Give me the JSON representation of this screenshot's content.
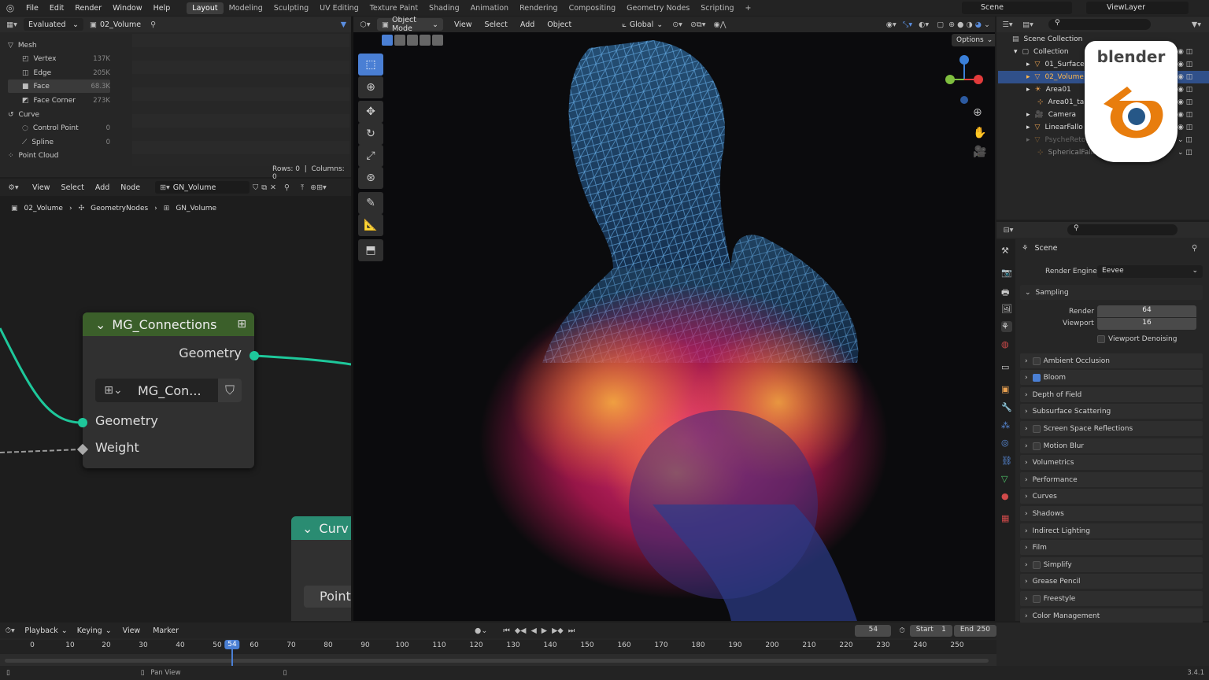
{
  "topbar": {
    "menus": [
      "File",
      "Edit",
      "Render",
      "Window",
      "Help"
    ],
    "workspaces": [
      "Layout",
      "Modeling",
      "Sculpting",
      "UV Editing",
      "Texture Paint",
      "Shading",
      "Animation",
      "Rendering",
      "Compositing",
      "Geometry Nodes",
      "Scripting"
    ],
    "scene": "Scene",
    "view_layer": "ViewLayer"
  },
  "spreadsheet": {
    "mode": "Evaluated",
    "object": "02_Volume",
    "rows_label": "Rows: 0",
    "cols_label": "Columns: 0",
    "items": [
      {
        "label": "Mesh"
      },
      {
        "label": "Vertex",
        "count": "137K"
      },
      {
        "label": "Edge",
        "count": "205K"
      },
      {
        "label": "Face",
        "count": "68.3K"
      },
      {
        "label": "Face Corner",
        "count": "273K"
      },
      {
        "label": "Curve"
      },
      {
        "label": "Control Point",
        "count": "0"
      },
      {
        "label": "Spline",
        "count": "0"
      },
      {
        "label": "Point Cloud"
      }
    ]
  },
  "node_editor": {
    "menus": [
      "View",
      "Select",
      "Add",
      "Node"
    ],
    "tree": "GN_Volume",
    "breadcrumb": [
      "02_Volume",
      "GeometryNodes",
      "GN_Volume"
    ],
    "node1": {
      "title": "MG_Connections",
      "out": "Geometry",
      "group": "MG_Con...",
      "in1": "Geometry",
      "in2": "Weight"
    },
    "node2": {
      "title": "Curv",
      "field": "Point"
    }
  },
  "viewport": {
    "mode": "Object Mode",
    "menus": [
      "View",
      "Select",
      "Add",
      "Object"
    ],
    "orientation": "Global",
    "options": "Options"
  },
  "outliner": {
    "root": "Scene Collection",
    "collection": "Collection",
    "items": [
      "01_Surface",
      "02_Volume",
      "Area01",
      "Area01_tar",
      "Camera",
      "LinearFallo",
      "PsycheRetopo",
      "SphericalFalloff"
    ]
  },
  "logo": {
    "text": "blender"
  },
  "properties": {
    "scene": "Scene",
    "engine_label": "Render Engine",
    "engine": "Eevee",
    "sampling": "Sampling",
    "render_label": "Render",
    "render_val": "64",
    "viewport_label": "Viewport",
    "viewport_val": "16",
    "denoise": "Viewport Denoising",
    "panels": [
      "Ambient Occlusion",
      "Bloom",
      "Depth of Field",
      "Subsurface Scattering",
      "Screen Space Reflections",
      "Motion Blur",
      "Volumetrics",
      "Performance",
      "Curves",
      "Shadows",
      "Indirect Lighting",
      "Film",
      "Simplify",
      "Grease Pencil",
      "Freestyle",
      "Color Management"
    ]
  },
  "timeline": {
    "menus": [
      "Playback",
      "Keying",
      "View",
      "Marker"
    ],
    "current": "54",
    "start_label": "Start",
    "start": "1",
    "end_label": "End",
    "end": "250",
    "ticks": [
      "0",
      "10",
      "20",
      "30",
      "40",
      "50",
      "54",
      "60",
      "70",
      "80",
      "90",
      "100",
      "110",
      "120",
      "130",
      "140",
      "150",
      "160",
      "170",
      "180",
      "190",
      "200",
      "210",
      "220",
      "230",
      "240",
      "250"
    ]
  },
  "status": {
    "hint": "Pan View",
    "version": "3.4.1"
  },
  "colors": {
    "accent": "#4a7fd4",
    "node_header": "#3b5f2a",
    "socket_green": "#1ec89b",
    "curve_header": "#2a8c72",
    "logo_orange": "#e87d0d"
  }
}
